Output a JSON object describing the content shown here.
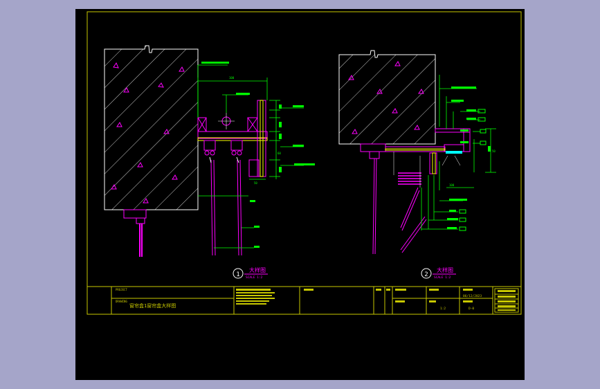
{
  "colors": {
    "background": "#a5a5c9",
    "sheet": "#000000",
    "frame": "#c8c800",
    "green": "#00ff00",
    "magenta": "#ff00ff",
    "white": "#ffffff",
    "yellow": "#ffff00",
    "cyan": "#00ffff"
  },
  "detail1": {
    "title": "大样图",
    "scale": "SCALE 1:2",
    "number": "1",
    "dims": [
      "100",
      "50",
      "60"
    ]
  },
  "detail2": {
    "title": "大样图",
    "scale": "SCALE 1:2",
    "number": "2",
    "dims": [
      "100",
      "50"
    ]
  },
  "titleblock": {
    "project_label": "PROJECT",
    "drawing_label": "DRAWING",
    "drawing_title": "窗帘盒1窗帘盒大样图",
    "scale_value": "1:2",
    "dwg_no_value": "D-0",
    "date_value": "06/12/2023"
  }
}
